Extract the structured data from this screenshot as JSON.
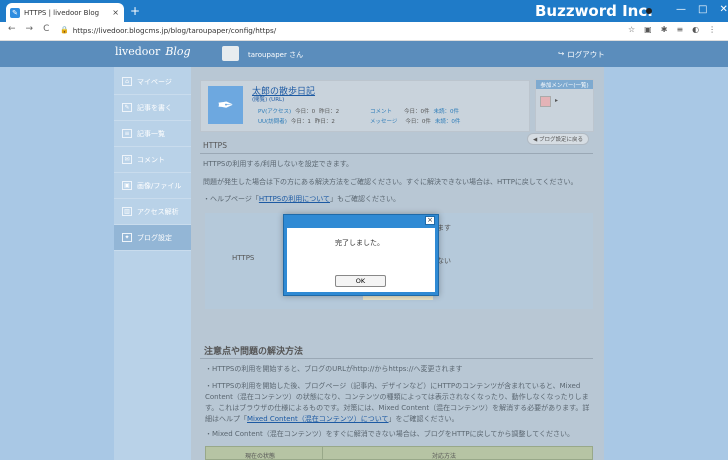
{
  "browser": {
    "tab_title": "HTTPS | livedoor Blog",
    "tab_close": "×",
    "new_tab": "+",
    "brand": "Buzzword Inc.",
    "window_controls": [
      "—",
      "□",
      "✕"
    ],
    "nav_icons": [
      "←",
      "→",
      "C"
    ],
    "url_lock": "🔒",
    "url": "https://livedoor.blogcms.jp/blog/taroupaper/config/https/",
    "ext_icons": [
      "☆",
      "▣",
      "✱",
      "≡",
      "◐",
      "⋮"
    ]
  },
  "header": {
    "logo_text": "livedoor",
    "logo_blog": "Blog",
    "user_name": "taroupaper さん",
    "logout_icon": "↪",
    "logout_label": "ログアウト"
  },
  "sidebar": {
    "items": [
      {
        "label": "マイページ",
        "icon": "⌂",
        "icon_name": "home-icon"
      },
      {
        "label": "記事を書く",
        "icon": "✎",
        "icon_name": "pencil-icon"
      },
      {
        "label": "記事一覧",
        "icon": "≡",
        "icon_name": "list-icon"
      },
      {
        "label": "コメント",
        "icon": "✉",
        "icon_name": "comment-icon"
      },
      {
        "label": "画像/ファイル",
        "icon": "▣",
        "icon_name": "image-icon"
      },
      {
        "label": "アクセス解析",
        "icon": "▥",
        "icon_name": "chart-icon"
      },
      {
        "label": "ブログ設定",
        "icon": "✦",
        "icon_name": "wrench-icon"
      }
    ]
  },
  "blog_card": {
    "title": "太郎の散歩日記",
    "links": "(閲覧) (URL)",
    "pv_label": "PV(アクセス)",
    "pv_today": "今日：0",
    "pv_yesterday": "昨日：2",
    "uu_label": "UU(訪問者)",
    "uu_today": "今日：1",
    "uu_yesterday": "昨日：2",
    "comment_label": "コメント",
    "comment_today": "今日：0件",
    "comment_unread": "未読：0件",
    "message_label": "メッセージ",
    "message_today": "今日：0件",
    "message_unread": "未読：0件"
  },
  "member": {
    "button": "参加メンバー(一覧)",
    "arrow": "▸"
  },
  "back_button": "◀ ブログ設定に戻る",
  "section": {
    "title": "HTTPS",
    "para1": "HTTPSの利用する/利用しないを設定できます。",
    "para2": "問題が発生した場合は下の方にある解決方法をご確認ください。すぐに解決できない場合は、HTTPに戻してください。",
    "para3_prefix": "・ヘルプページ「",
    "para3_link": "HTTPSの利用について",
    "para3_suffix": "」もご確認ください。"
  },
  "settings": {
    "https_label": "HTTPS",
    "row_right_1": "ます",
    "row_right_2": "ない"
  },
  "section2": {
    "title": "注意点や問題の解決方法",
    "p1": "・HTTPSの利用を開始すると、ブログのURLがhttp://からhttps://へ変更されます",
    "p2_line1": "・HTTPSの利用を開始した後、ブログページ（記事内、デザインなど）にHTTPのコンテンツが含まれていると、Mixed",
    "p2_line2": "Content（混在コンテンツ）の状態になり、コンテンツの種類によっては表示されなくなったり、動作しなくなったりしま",
    "p2_line3": "す。これはブラウザの仕様によるものです。対策には、Mixed Content（混在コンテンツ）を解消する必要があります。詳",
    "p2_line4_prefix": "細はヘルプ「",
    "p2_line4_link": "Mixed Content（混在コンテンツ）について",
    "p2_line4_suffix": "」をご確認ください。",
    "p3": "・Mixed Content（混在コンテンツ）をすぐに解消できない場合は、ブログをHTTPに戻してから調整してください。"
  },
  "table": {
    "col1": "現在の状態",
    "col2": "対応方法"
  },
  "dialog": {
    "close": "×",
    "message": "完了しました。",
    "ok": "OK"
  }
}
